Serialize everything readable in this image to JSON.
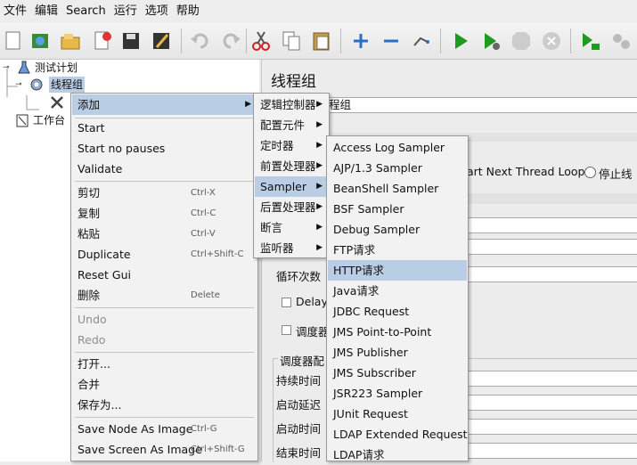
{
  "menubar": [
    "文件",
    "编辑",
    "Search",
    "运行",
    "选项",
    "帮助"
  ],
  "tree": {
    "test_plan": "测试计划",
    "thread_group": "线程组",
    "workbench": "工作台"
  },
  "panel": {
    "title": "线程组",
    "name_value": "程组",
    "start_next_loop": "art Next Thread Loop",
    "stop_thread": "停止线",
    "loop_count": "循环次数",
    "delay": "Delay",
    "scheduler": "调度器",
    "scheduler_config": "调度器配",
    "duration": "持续时间",
    "startup_delay": "启动延迟",
    "start_time": "启动时间",
    "end_time": "结束时间"
  },
  "context_menu": {
    "add": "添加",
    "start": "Start",
    "start_no_pauses": "Start no pauses",
    "validate": "Validate",
    "cut": "剪切",
    "cut_sc": "Ctrl-X",
    "copy": "复制",
    "copy_sc": "Ctrl-C",
    "paste": "粘贴",
    "paste_sc": "Ctrl-V",
    "duplicate": "Duplicate",
    "duplicate_sc": "Ctrl+Shift-C",
    "reset_gui": "Reset Gui",
    "delete": "删除",
    "delete_sc": "Delete",
    "undo": "Undo",
    "redo": "Redo",
    "open": "打开...",
    "merge": "合并",
    "save_as": "保存为...",
    "save_node_image": "Save Node As Image",
    "save_node_image_sc": "Ctrl-G",
    "save_screen_image": "Save Screen As Image",
    "save_screen_image_sc": "Ctrl+Shift-G"
  },
  "add_submenu": [
    "逻辑控制器",
    "配置元件",
    "定时器",
    "前置处理器",
    "Sampler",
    "后置处理器",
    "断言",
    "监听器"
  ],
  "sampler_submenu": [
    "Access Log Sampler",
    "AJP/1.3 Sampler",
    "BeanShell Sampler",
    "BSF Sampler",
    "Debug Sampler",
    "FTP请求",
    "HTTP请求",
    "Java请求",
    "JDBC Request",
    "JMS Point-to-Point",
    "JMS Publisher",
    "JMS Subscriber",
    "JSR223 Sampler",
    "JUnit Request",
    "LDAP Extended Request",
    "LDAP请求"
  ],
  "colors": {
    "highlight": "#b9cde5",
    "menu_bg": "#f2f2f2",
    "run_green": "#1e9a1e"
  }
}
